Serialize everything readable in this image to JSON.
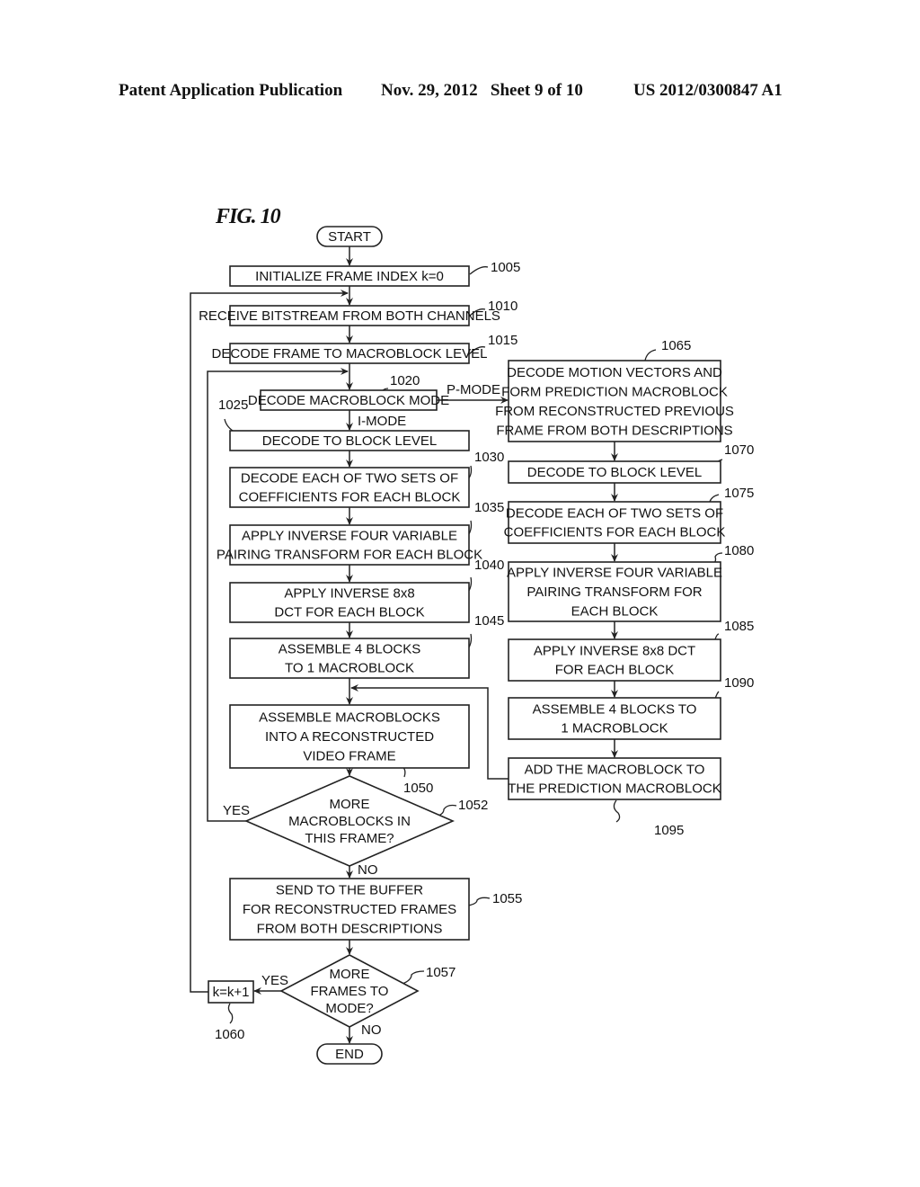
{
  "header": {
    "publication": "Patent Application Publication",
    "date_sheet": "Nov. 29, 2012   Sheet 9 of 10",
    "patent_number": "US 2012/0300847 A1"
  },
  "figure": {
    "label": "FIG. 10",
    "terminals": {
      "start": "START",
      "end": "END"
    },
    "steps": {
      "s1005": {
        "ref": "1005",
        "lines": [
          "INITIALIZE FRAME INDEX k=0"
        ]
      },
      "s1010": {
        "ref": "1010",
        "lines": [
          "RECEIVE BITSTREAM FROM BOTH CHANNELS"
        ]
      },
      "s1015": {
        "ref": "1015",
        "lines": [
          "DECODE FRAME TO MACROBLOCK LEVEL"
        ]
      },
      "s1020": {
        "ref": "1020",
        "lines": [
          "DECODE MACROBLOCK MODE"
        ]
      },
      "s1025": {
        "ref": "1025",
        "lines": [
          "DECODE TO BLOCK LEVEL"
        ]
      },
      "s1030": {
        "ref": "1030",
        "lines": [
          "DECODE EACH OF TWO SETS OF",
          "COEFFICIENTS FOR EACH BLOCK"
        ]
      },
      "s1035": {
        "ref": "1035",
        "lines": [
          "APPLY INVERSE FOUR VARIABLE",
          "PAIRING TRANSFORM FOR EACH BLOCK"
        ]
      },
      "s1040": {
        "ref": "1040",
        "lines": [
          "APPLY INVERSE 8x8",
          "DCT FOR EACH BLOCK"
        ]
      },
      "s1045": {
        "ref": "1045",
        "lines": [
          "ASSEMBLE 4 BLOCKS",
          "TO 1 MACROBLOCK"
        ]
      },
      "s1050": {
        "ref": "1050",
        "lines": [
          "ASSEMBLE MACROBLOCKS",
          "INTO A RECONSTRUCTED",
          "VIDEO FRAME"
        ]
      },
      "s1052": {
        "ref": "1052",
        "lines": [
          "MORE",
          "MACROBLOCKS IN",
          "THIS FRAME?"
        ]
      },
      "s1055": {
        "ref": "1055",
        "lines": [
          "SEND TO THE BUFFER",
          "FOR RECONSTRUCTED FRAMES",
          "FROM BOTH DESCRIPTIONS"
        ]
      },
      "s1057": {
        "ref": "1057",
        "lines": [
          "MORE",
          "FRAMES TO",
          "MODE?"
        ]
      },
      "s1060": {
        "ref": "1060",
        "lines": [
          "k=k+1"
        ]
      },
      "s1065": {
        "ref": "1065",
        "lines": [
          "DECODE MOTION VECTORS AND",
          "FORM PREDICTION MACROBLOCK",
          "FROM RECONSTRUCTED PREVIOUS",
          "FRAME FROM BOTH DESCRIPTIONS"
        ]
      },
      "s1070": {
        "ref": "1070",
        "lines": [
          "DECODE TO BLOCK LEVEL"
        ]
      },
      "s1075": {
        "ref": "1075",
        "lines": [
          "DECODE EACH OF TWO SETS OF",
          "COEFFICIENTS FOR EACH BLOCK"
        ]
      },
      "s1080": {
        "ref": "1080",
        "lines": [
          "APPLY INVERSE FOUR VARIABLE",
          "PAIRING TRANSFORM FOR",
          "EACH BLOCK"
        ]
      },
      "s1085": {
        "ref": "1085",
        "lines": [
          "APPLY INVERSE 8x8 DCT",
          "FOR EACH BLOCK"
        ]
      },
      "s1090": {
        "ref": "1090",
        "lines": [
          "ASSEMBLE 4 BLOCKS TO",
          "1 MACROBLOCK"
        ]
      },
      "s1095": {
        "ref": "1095",
        "lines": [
          "ADD THE MACROBLOCK TO",
          "THE PREDICTION MACROBLOCK"
        ]
      }
    },
    "edge_labels": {
      "p_mode": "P-MODE",
      "i_mode": "I-MODE",
      "yes_1052": "YES",
      "no_1052": "NO",
      "yes_1057": "YES",
      "no_1057": "NO"
    }
  }
}
